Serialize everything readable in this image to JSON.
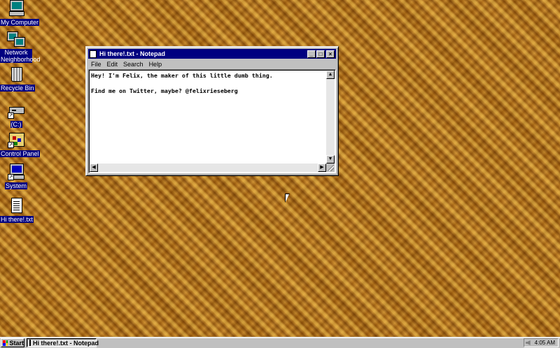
{
  "desktop": {
    "icons": [
      {
        "label": "My Computer",
        "icon": "my-computer-icon"
      },
      {
        "label": "Network Neighborhood",
        "icon": "network-neighborhood-icon"
      },
      {
        "label": "Recycle Bin",
        "icon": "recycle-bin-icon"
      },
      {
        "label": "(C:)",
        "icon": "drive-icon"
      },
      {
        "label": "Control Panel",
        "icon": "control-panel-icon"
      },
      {
        "label": "System",
        "icon": "system-icon"
      },
      {
        "label": "Hi there!.txt",
        "icon": "text-file-icon"
      }
    ]
  },
  "notepad": {
    "title": "Hi there!.txt - Notepad",
    "menu": [
      {
        "label": "File"
      },
      {
        "label": "Edit"
      },
      {
        "label": "Search"
      },
      {
        "label": "Help"
      }
    ],
    "content": "Hey! I'm Felix, the maker of this little dumb thing.\n\nFind me on Twitter, maybe? @felixrieseberg",
    "buttons": {
      "minimize": "_",
      "maximize": "□",
      "close": "×"
    }
  },
  "taskbar": {
    "start_label": "Start",
    "task_label": "Hi there!.txt - Notepad",
    "clock": "4:05 AM"
  }
}
